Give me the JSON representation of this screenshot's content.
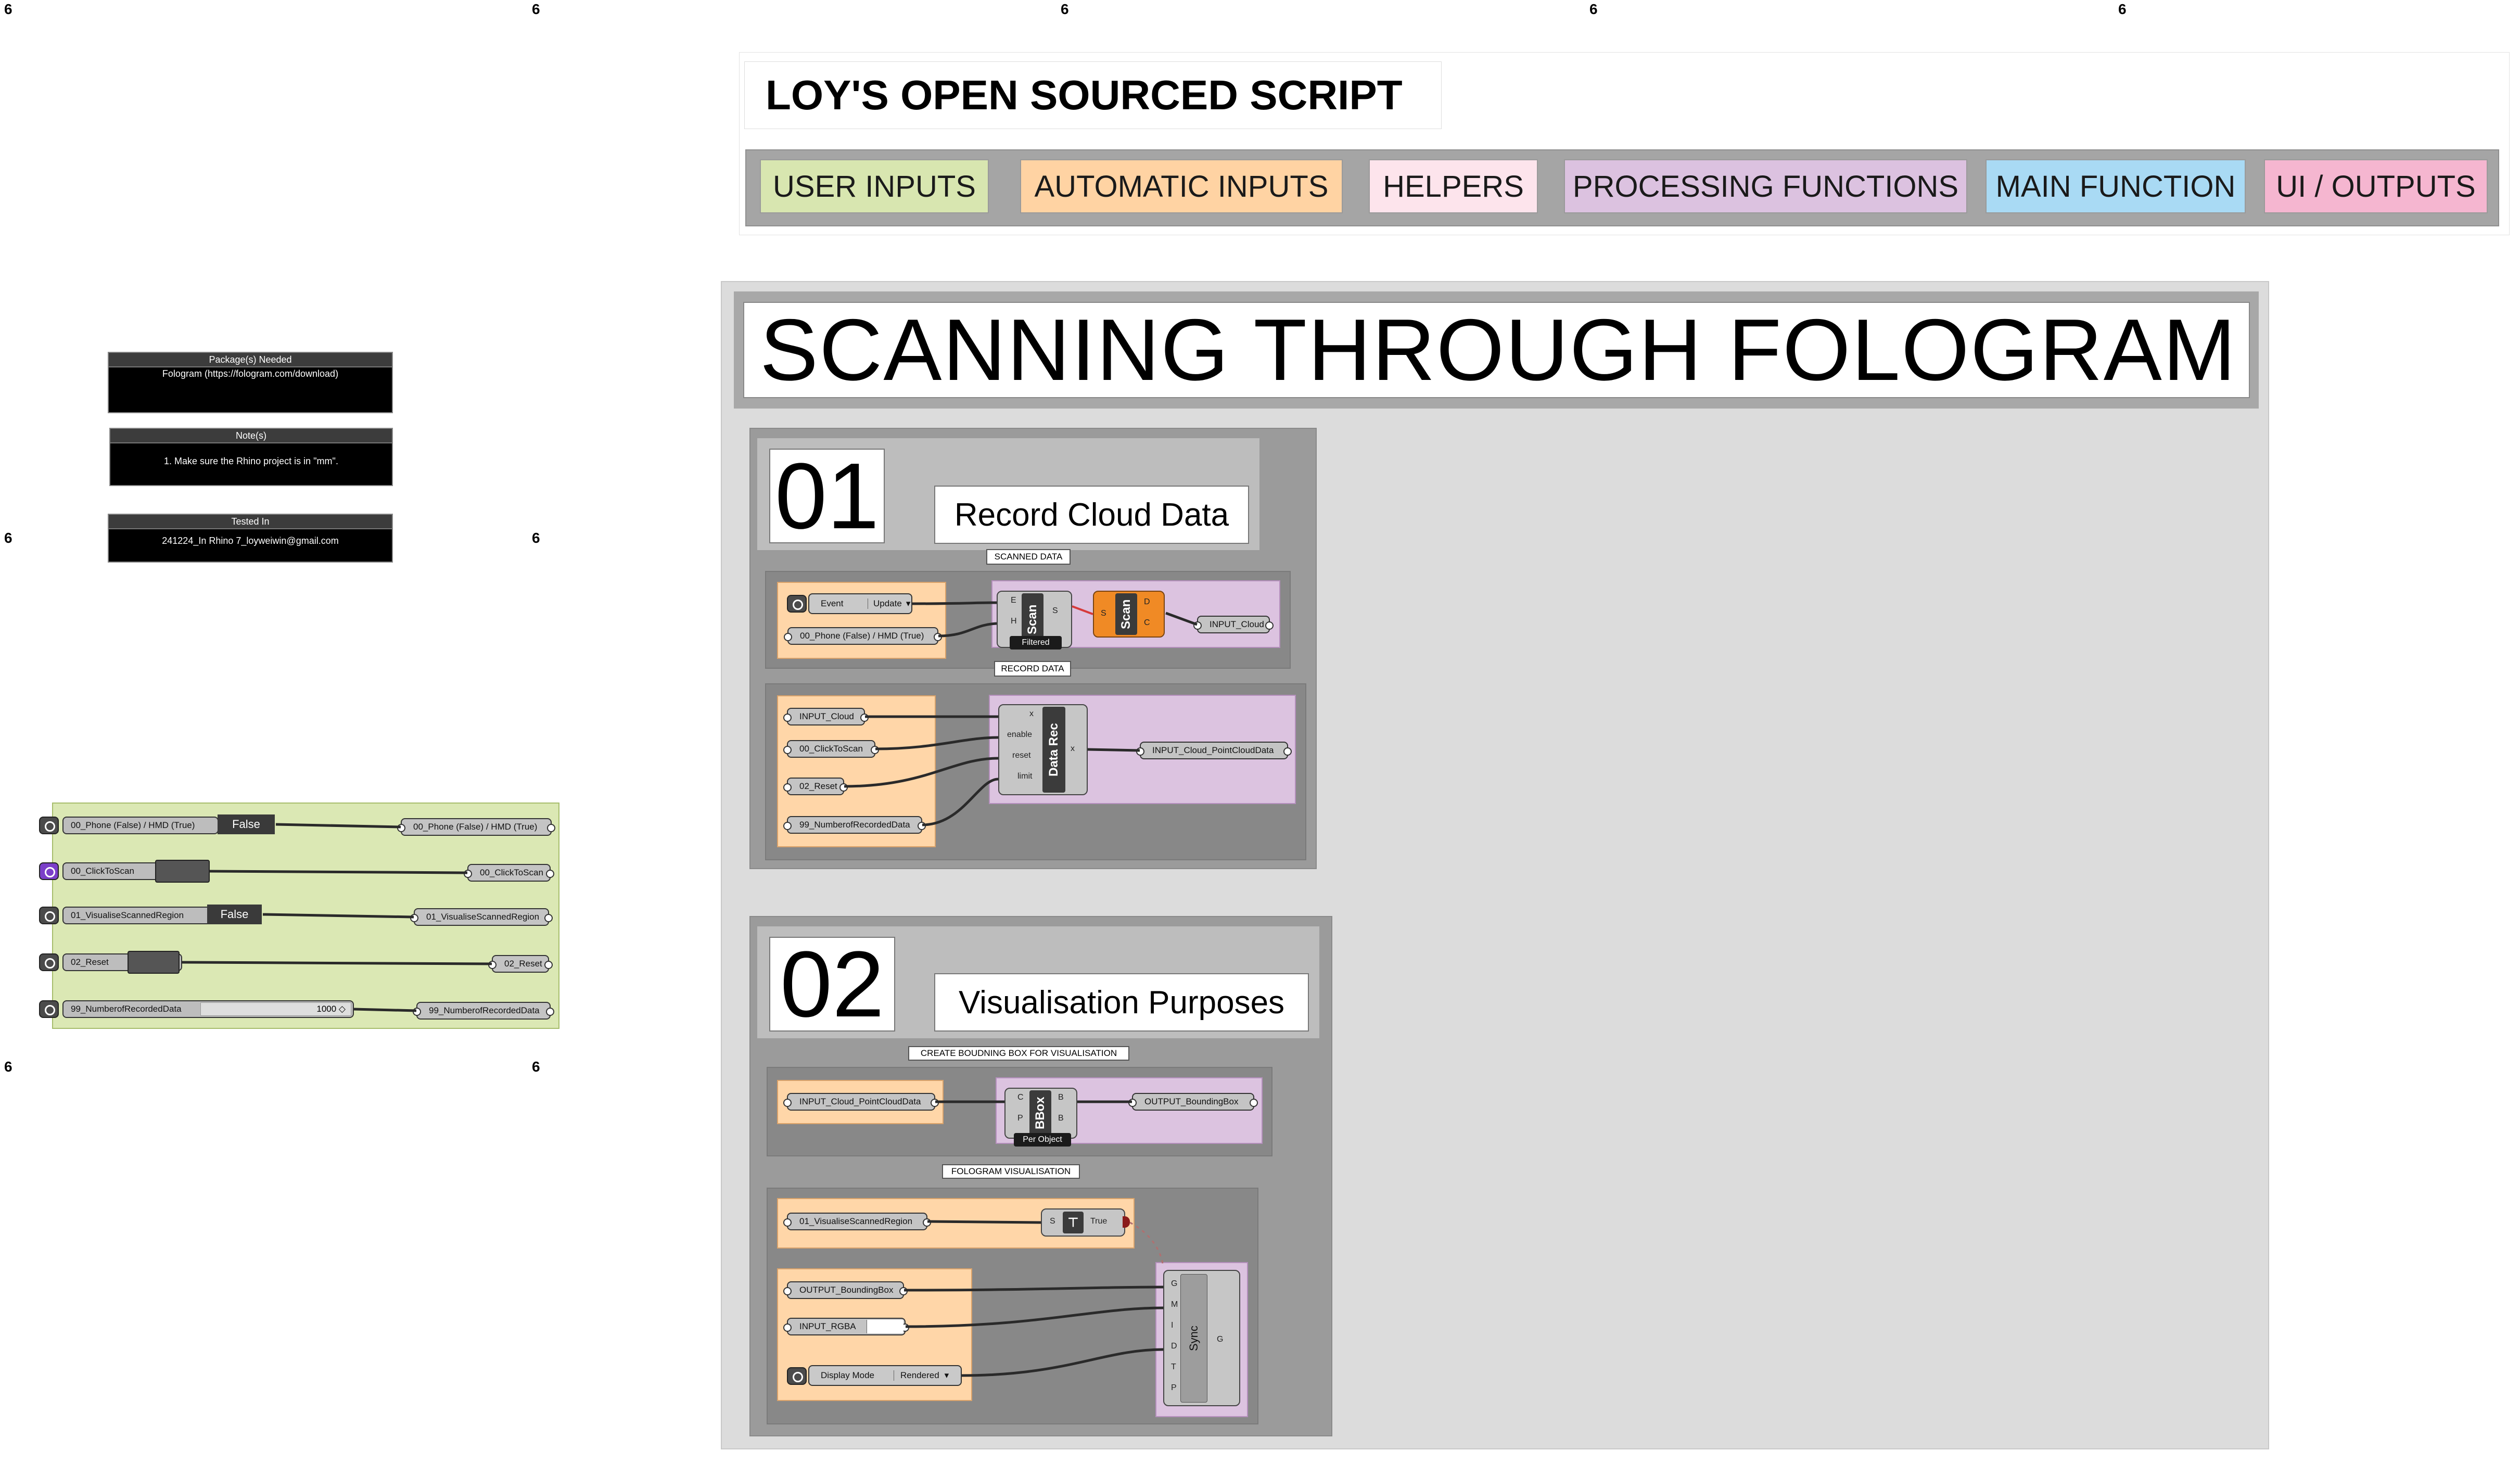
{
  "corner_marks": "6",
  "header": {
    "title": "LOY'S OPEN SOURCED SCRIPT",
    "legend": [
      {
        "label": "USER INPUTS",
        "color": "#d8e6b0"
      },
      {
        "label": "AUTOMATIC INPUTS",
        "color": "#ffd3a3"
      },
      {
        "label": "HELPERS",
        "color": "#fde4ec"
      },
      {
        "label": "PROCESSING FUNCTIONS",
        "color": "#dcc2e0"
      },
      {
        "label": "MAIN FUNCTION",
        "color": "#a9daf4"
      },
      {
        "label": "UI / OUTPUTS",
        "color": "#f5b6d0"
      }
    ]
  },
  "main_title": "SCANNING THROUGH FOLOGRAM",
  "notes": [
    {
      "head": "Package(s) Needed",
      "body": "Fologram (https://fologram.com/download)"
    },
    {
      "head": "Note(s)",
      "body": "1. Make sure the Rhino project is in \"mm\"."
    },
    {
      "head": "Tested In",
      "body": "241224_In Rhino 7_loyweiwin@gmail.com"
    }
  ],
  "user_inputs": [
    {
      "name": "00_Phone (False) / HMD (True)",
      "value": "False",
      "out": "00_Phone (False) / HMD (True)"
    },
    {
      "name": "00_ClickToScan",
      "value": "",
      "out": "00_ClickToScan"
    },
    {
      "name": "01_VisualiseScannedRegion",
      "value": "False",
      "out": "01_VisualiseScannedRegion"
    },
    {
      "name": "02_Reset",
      "value": "",
      "out": "02_Reset"
    },
    {
      "name": "99_NumberofRecordedData",
      "value": "1000 ◇",
      "out": "99_NumberofRecordedData"
    }
  ],
  "section1": {
    "number": "01",
    "title": "Record Cloud Data",
    "scanned_tag": "SCANNED DATA",
    "record_tag": "RECORD DATA",
    "event_label": "Event",
    "event_value": "Update",
    "phone_param": "00_Phone (False) / HMD (True)",
    "scan_core": "Scan",
    "scan_pins_in": [
      "E",
      "H"
    ],
    "scan_pin_out": "S",
    "filtered_label": "Filtered",
    "scan2_pin_in": "S",
    "scan2_pins_out": [
      "D",
      "C"
    ],
    "input_cloud_out": "INPUT_Cloud",
    "rec_params": [
      "INPUT_Cloud",
      "00_ClickToScan",
      "02_Reset",
      "99_NumberofRecordedData"
    ],
    "rec_core": "Data Rec",
    "rec_pins_in": [
      "x",
      "enable",
      "reset",
      "limit"
    ],
    "rec_pin_out": "x",
    "rec_out": "INPUT_Cloud_PointCloudData"
  },
  "section2": {
    "number": "02",
    "title": "Visualisation Purposes",
    "bbox_tag": "CREATE BOUDNING BOX FOR VISUALISATION",
    "vis_tag": "FOLOGRAM VISUALISATION",
    "bbox_in": "INPUT_Cloud_PointCloudData",
    "bbox_core": "BBox",
    "bbox_pins_in": [
      "C",
      "P"
    ],
    "bbox_pins_out": [
      "B",
      "B"
    ],
    "per_object": "Per Object",
    "bbox_out": "OUTPUT_BoundingBox",
    "vis_param": "01_VisualiseScannedRegion",
    "gate_pin": "S",
    "gate_value": "True",
    "sync_params": [
      "OUTPUT_BoundingBox",
      "INPUT_RGBA"
    ],
    "display_label": "Display Mode",
    "display_value": "Rendered",
    "sync_core": "Sync",
    "sync_pins_in": [
      "G",
      "M",
      "I",
      "D",
      "T",
      "P"
    ],
    "sync_pin_out": "G"
  }
}
